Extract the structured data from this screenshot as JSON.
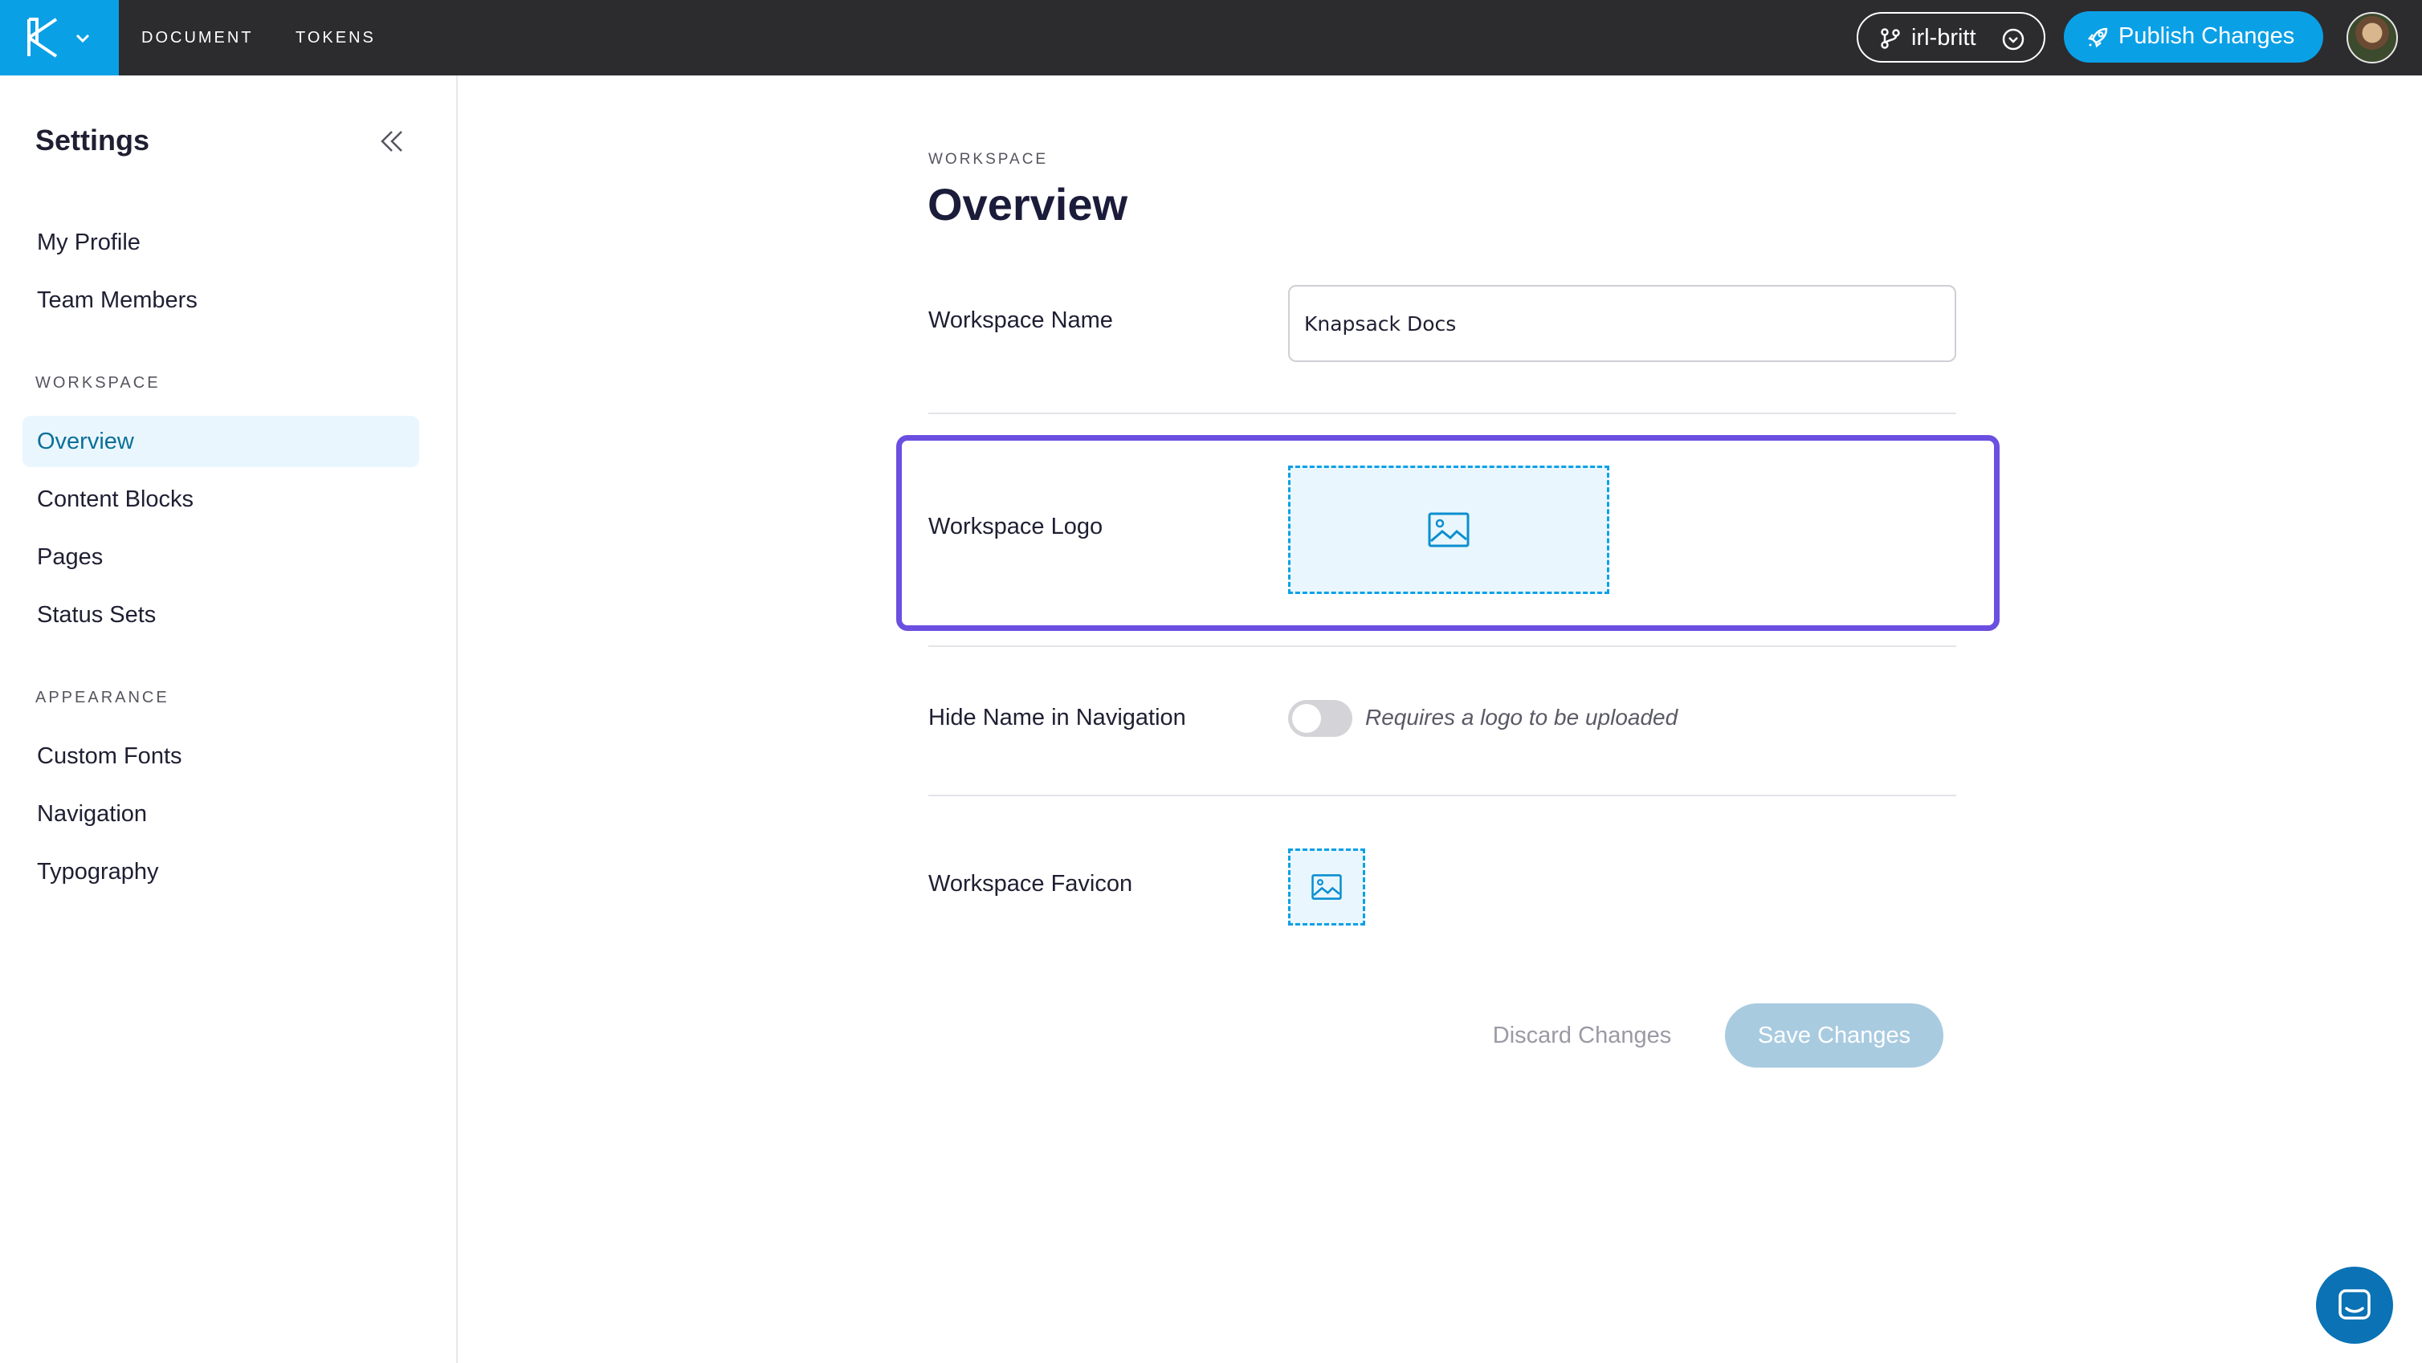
{
  "topbar": {
    "tabs": [
      "DOCUMENT",
      "TOKENS"
    ],
    "branch": "irl-britt",
    "publish_label": "Publish Changes",
    "brand_color": "#0aa0e6"
  },
  "sidebar": {
    "title": "Settings",
    "items_top": [
      "My Profile",
      "Team Members"
    ],
    "section_workspace": "WORKSPACE",
    "items_workspace": [
      "Overview",
      "Content Blocks",
      "Pages",
      "Status Sets"
    ],
    "section_appearance": "APPEARANCE",
    "items_appearance": [
      "Custom Fonts",
      "Navigation",
      "Typography"
    ],
    "active": "Overview"
  },
  "main": {
    "eyebrow": "WORKSPACE",
    "title": "Overview",
    "workspace_name_label": "Workspace Name",
    "workspace_name_value": "Knapsack Docs",
    "workspace_logo_label": "Workspace Logo",
    "hide_name_label": "Hide Name in Navigation",
    "hide_name_hint": "Requires a logo to be uploaded",
    "hide_name_enabled": false,
    "workspace_favicon_label": "Workspace Favicon",
    "discard_label": "Discard Changes",
    "save_label": "Save Changes",
    "highlight_color": "#6b4fe0"
  },
  "icons": [
    "knapsack-logo-icon",
    "chevron-down-icon",
    "git-branch-icon",
    "rocket-icon",
    "collapse-double-chevron-icon",
    "image-icon",
    "chat-icon"
  ]
}
